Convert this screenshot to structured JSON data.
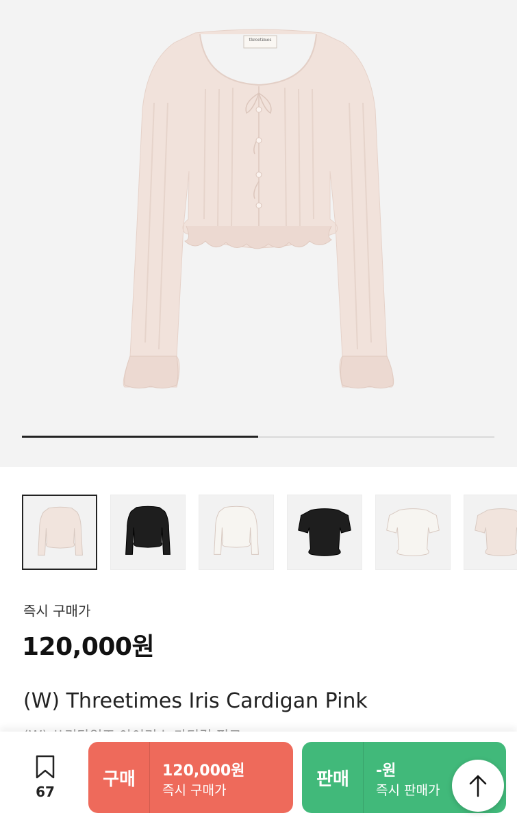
{
  "hero": {
    "product_image": "pink-knit-cardigan",
    "label_text": "threetimes",
    "carousel_progress": 0.5
  },
  "thumbnails": [
    {
      "name": "pink-cardigan",
      "color": "#f1e4dd",
      "selected": true
    },
    {
      "name": "black-cardigan",
      "color": "#1e1e1e",
      "selected": false
    },
    {
      "name": "white-cardigan",
      "color": "#f7f5f1",
      "selected": false
    },
    {
      "name": "black-short-sleeve",
      "color": "#1e1e1e",
      "selected": false
    },
    {
      "name": "white-short-sleeve",
      "color": "#f7f5f1",
      "selected": false
    },
    {
      "name": "pink-short-sleeve",
      "color": "#f1e4dd",
      "selected": false
    }
  ],
  "price": {
    "label": "즉시 구매가",
    "value": "120,000원"
  },
  "product": {
    "title": "(W) Threetimes Iris Cardigan Pink",
    "subtitle": "(W) 쓰리타임즈 아이리스 가디건 핑크"
  },
  "bottom_bar": {
    "bookmark_icon": "bookmark-icon",
    "bookmark_count": "67",
    "buy": {
      "label": "구매",
      "price": "120,000원",
      "sub": "즉시 구매가",
      "color": "#ee6a5b"
    },
    "sell": {
      "label": "판매",
      "price": "-원",
      "sub": "즉시 판매가",
      "color": "#41b97a"
    },
    "scroll_top_icon": "arrow-up-icon"
  }
}
